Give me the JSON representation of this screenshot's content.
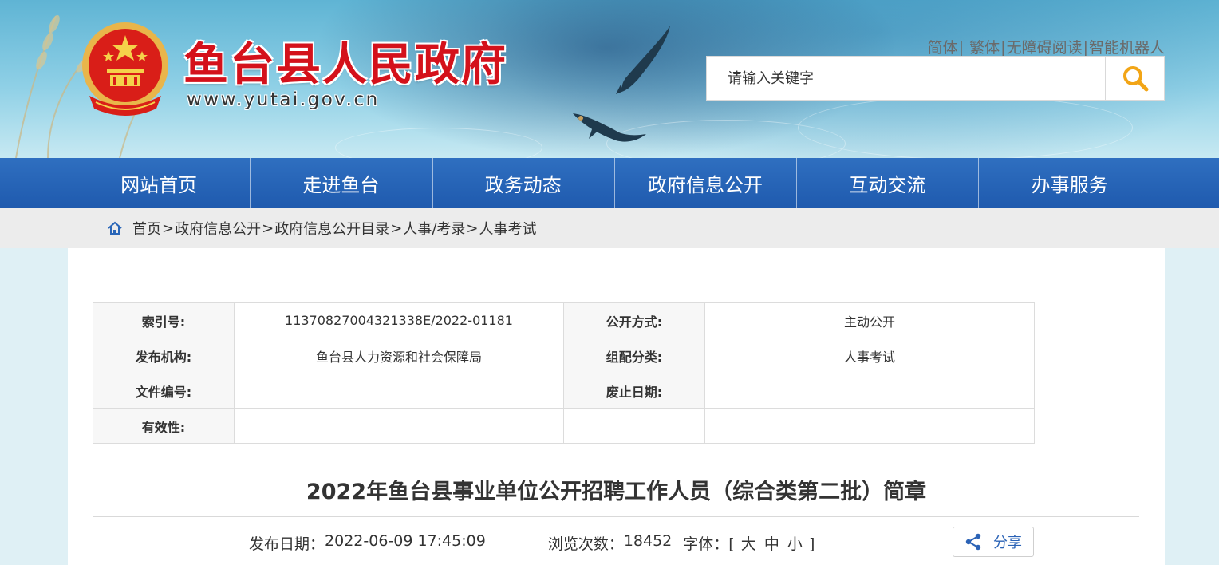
{
  "header": {
    "site_title": "鱼台县人民政府",
    "site_url": "www.yutai.gov.cn",
    "top_links": [
      "简体",
      "繁体",
      "无障碍阅读",
      "智能机器人"
    ],
    "search": {
      "placeholder": "请输入关键字"
    }
  },
  "nav": {
    "items": [
      "网站首页",
      "走进鱼台",
      "政务动态",
      "政府信息公开",
      "互动交流",
      "办事服务"
    ]
  },
  "breadcrumb": [
    "首页",
    "政府信息公开",
    "政府信息公开目录",
    "人事/考录",
    "人事考试"
  ],
  "meta": {
    "index_label": "索引号:",
    "index_value": "11370827004321338E/2022-01181",
    "disclosure_label": "公开方式:",
    "disclosure_value": "主动公开",
    "publisher_label": "发布机构:",
    "publisher_value": "鱼台县人力资源和社会保障局",
    "category_label": "组配分类:",
    "category_value": "人事考试",
    "doc_no_label": "文件编号:",
    "doc_no_value": "",
    "expiry_label": "废止日期:",
    "expiry_value": "",
    "validity_label": "有效性:",
    "validity_value": ""
  },
  "article": {
    "title": "2022年鱼台县事业单位公开招聘工作人员（综合类第二批）简章",
    "pub_date_label": "发布日期：",
    "pub_date": "2022-06-09 17:45:09",
    "views_label": "浏览次数：",
    "views": "18452",
    "font_label": "字体：",
    "font_open": "[",
    "font_large": "大",
    "font_medium": "中",
    "font_small": "小",
    "font_close": "]",
    "share_label": "分享"
  },
  "colors": {
    "title_red": "#d4111b",
    "nav_blue": "#2a66b8",
    "search_icon_orange": "#f2a516",
    "share_blue": "#2b63b6"
  }
}
